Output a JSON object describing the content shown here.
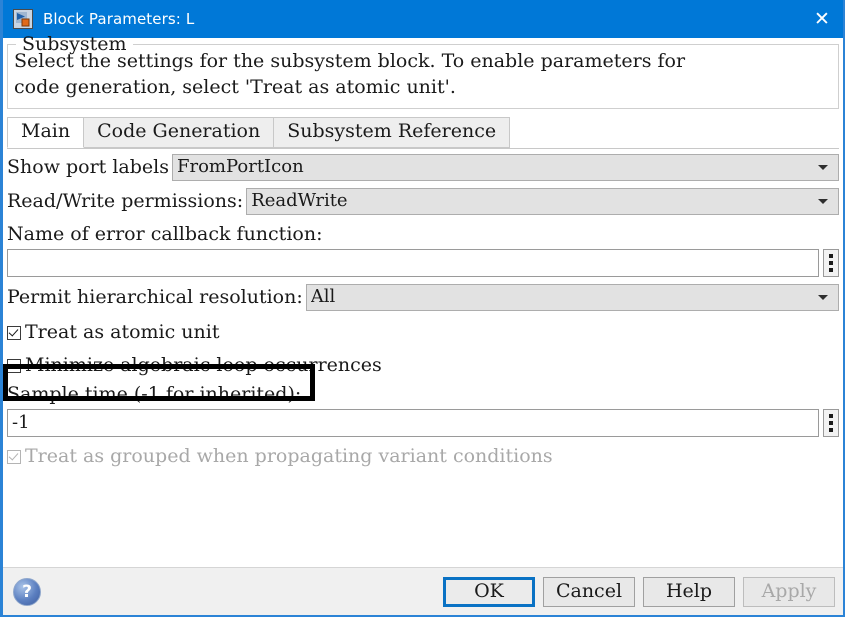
{
  "window": {
    "title": "Block Parameters: L",
    "icon": "simulink-block-icon",
    "close_label": "✕",
    "accent_color": "#0078d7"
  },
  "description": {
    "legend": "Subsystem",
    "body": "Select the settings for the subsystem block. To enable parameters for\ncode generation, select 'Treat as atomic unit'."
  },
  "tabs": [
    {
      "label": "Main",
      "active": true
    },
    {
      "label": "Code Generation",
      "active": false
    },
    {
      "label": "Subsystem Reference",
      "active": false
    }
  ],
  "fields": {
    "show_port_labels": {
      "label": "Show port labels",
      "value": "FromPortIcon"
    },
    "read_write_permissions": {
      "label": "Read/Write permissions:",
      "value": "ReadWrite"
    },
    "error_callback": {
      "label": "Name of error callback function:",
      "value": "",
      "browse_icon": "vertical-dots-icon"
    },
    "permit_hierarchical_resolution": {
      "label": "Permit hierarchical resolution:",
      "value": "All"
    },
    "treat_as_atomic_unit": {
      "label": "Treat as atomic unit",
      "checked": true,
      "highlighted": true
    },
    "minimize_algebraic_loop": {
      "label": "Minimize algebraic loop occurrences",
      "checked": false
    },
    "sample_time": {
      "label": "Sample time (-1 for inherited):",
      "value": "-1",
      "browse_icon": "vertical-dots-icon"
    },
    "treat_as_grouped": {
      "label": "Treat as grouped when propagating variant conditions",
      "checked": true,
      "disabled": true
    }
  },
  "footer": {
    "help_icon": "help-question-icon",
    "buttons": [
      {
        "label": "OK",
        "state": "default-focused"
      },
      {
        "label": "Cancel",
        "state": "normal"
      },
      {
        "label": "Help",
        "state": "normal"
      },
      {
        "label": "Apply",
        "state": "disabled"
      }
    ]
  }
}
